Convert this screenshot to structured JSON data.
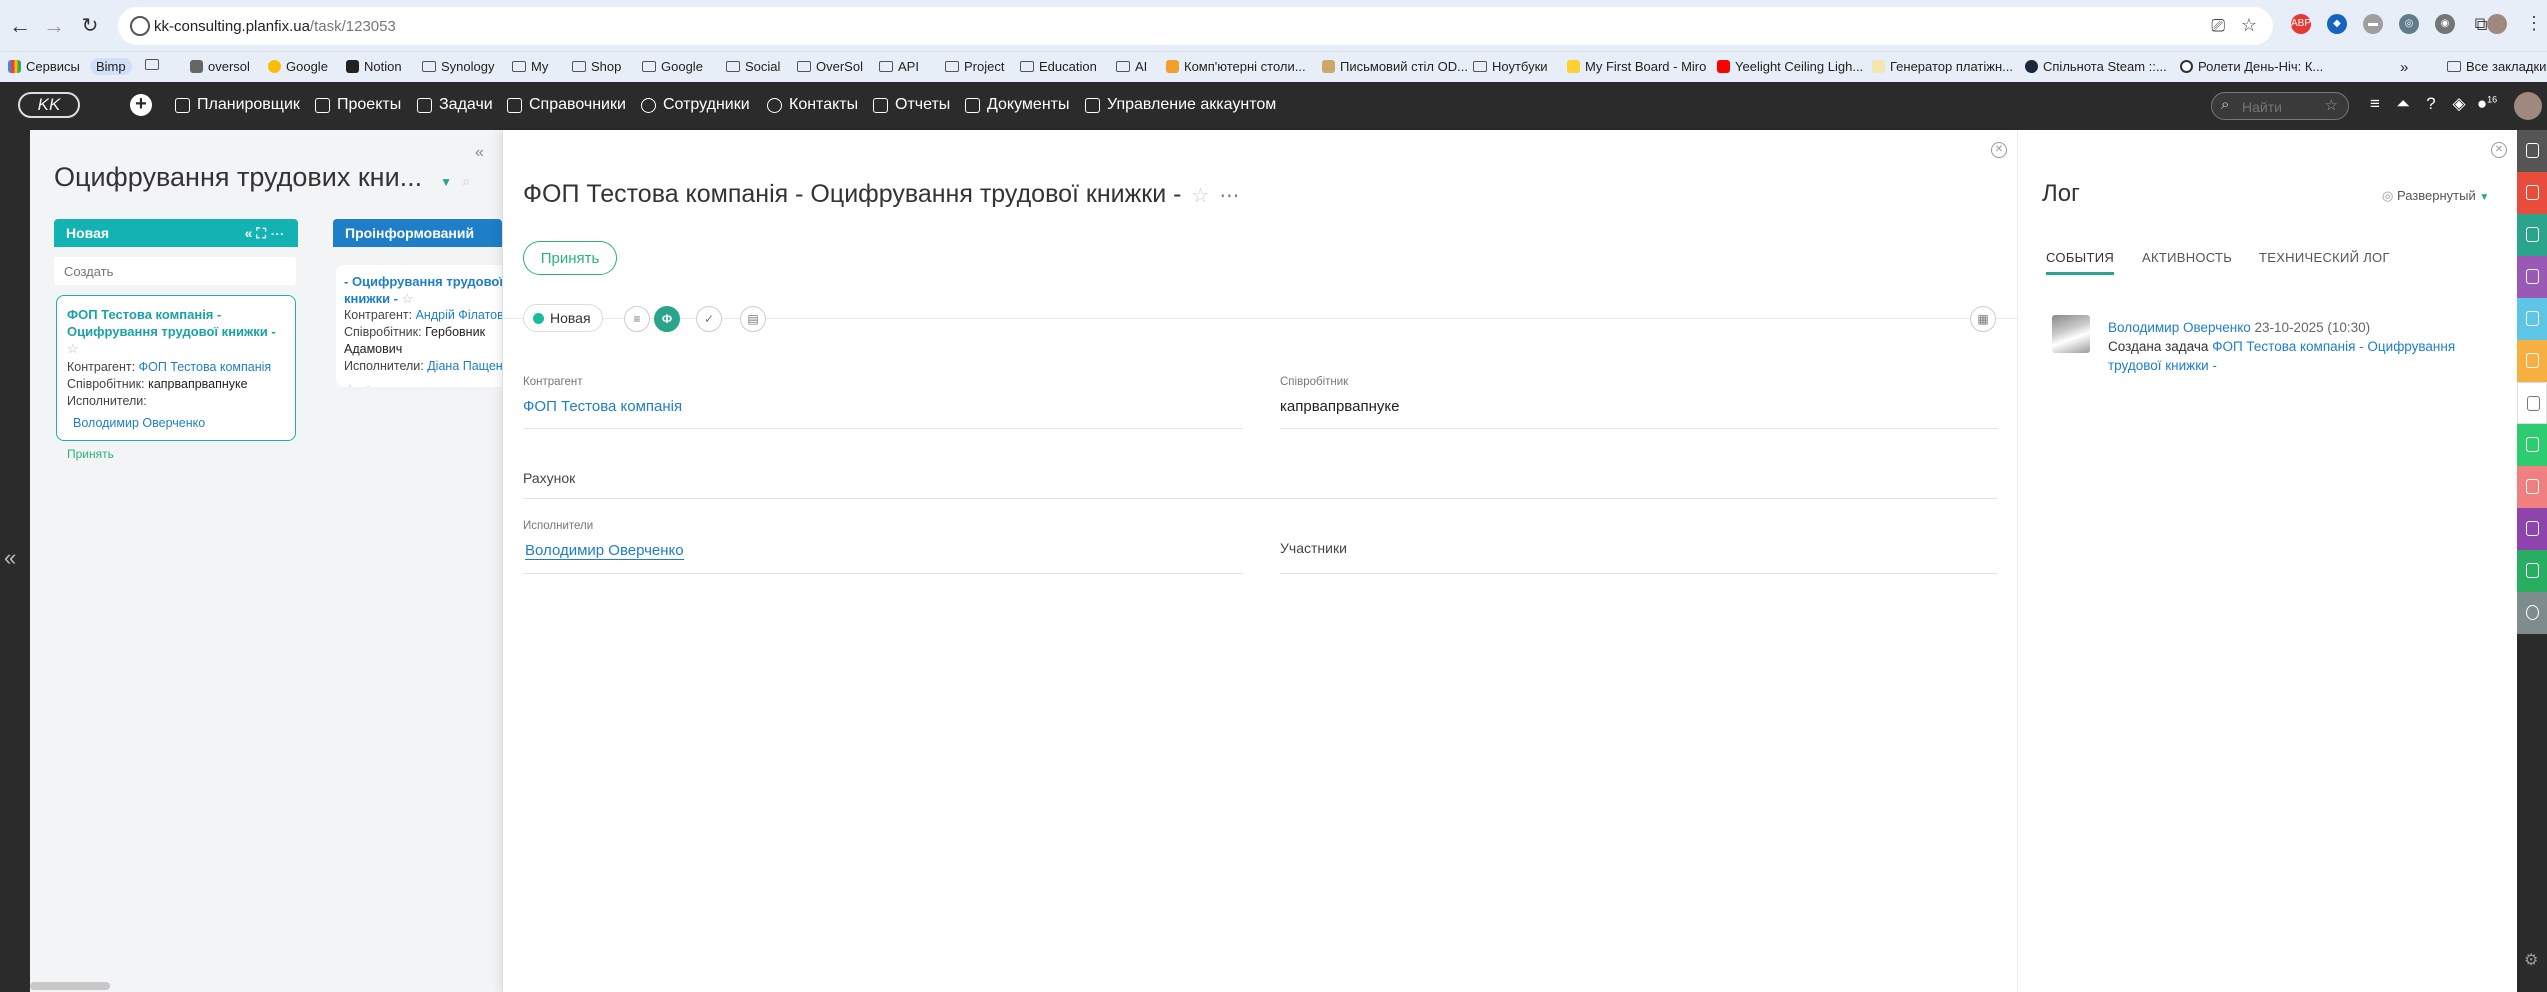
{
  "browser": {
    "url_domain": "kk-consulting.planfix.ua",
    "url_path": "/task/123053",
    "bookmarks": [
      {
        "label": "Сервисы",
        "icon": "grid-icon"
      },
      {
        "label": "Bimp",
        "icon": "bookmark-icon"
      },
      {
        "label": "",
        "icon": "apps-icon"
      },
      {
        "label": "oversol",
        "icon": "page-icon"
      },
      {
        "label": "Google",
        "icon": "google-icon"
      },
      {
        "label": "Notion",
        "icon": "notion-icon"
      },
      {
        "label": "Synology",
        "icon": "folder-icon"
      },
      {
        "label": "My",
        "icon": "folder-icon"
      },
      {
        "label": "Shop",
        "icon": "folder-icon"
      },
      {
        "label": "Google",
        "icon": "folder-icon"
      },
      {
        "label": "Social",
        "icon": "folder-icon"
      },
      {
        "label": "OverSol",
        "icon": "folder-icon"
      },
      {
        "label": "API",
        "icon": "folder-icon"
      },
      {
        "label": "Project",
        "icon": "folder-icon"
      },
      {
        "label": "Education",
        "icon": "folder-icon"
      },
      {
        "label": "AI",
        "icon": "folder-icon"
      },
      {
        "label": "Комп'ютерні столи...",
        "icon": "page-icon"
      },
      {
        "label": "Письмовий стіл OD...",
        "icon": "page-icon"
      },
      {
        "label": "Ноутбуки",
        "icon": "folder-icon"
      },
      {
        "label": "My First Board - Miro",
        "icon": "miro-icon"
      },
      {
        "label": "Yeelight Ceiling Ligh...",
        "icon": "youtube-icon"
      },
      {
        "label": "Генератор платіжн...",
        "icon": "page-icon"
      },
      {
        "label": "Спільнота Steam ::...",
        "icon": "steam-icon"
      },
      {
        "label": "Ролети День-Ніч: К...",
        "icon": "page-icon"
      }
    ],
    "bookmarks_all": "Все закладки"
  },
  "nav": {
    "items": [
      "Планировщик",
      "Проекты",
      "Задачи",
      "Справочники",
      "Сотрудники",
      "Контакты",
      "Отчеты",
      "Документы",
      "Управление аккаунтом"
    ],
    "search_placeholder": "Найти",
    "notif_count": "16"
  },
  "planner": {
    "title": "Оцифрування трудових кни...",
    "columns": [
      {
        "name": "Новая",
        "color": "#14b3b3"
      },
      {
        "name": "Проінформований",
        "color": "#1e7ec7"
      }
    ],
    "create_placeholder": "Создать",
    "card1": {
      "title": "ФОП Тестова компанія - Оцифрування трудової книжки -",
      "contragent_label": "Контрагент:",
      "contragent": "ФОП Тестова компанія",
      "employee_label": "Співробітник:",
      "employee": "капрвапрвапнуке",
      "executors_label": "Исполнители:",
      "executor": "Володимир Оверченко",
      "accept": "Принять"
    },
    "card2": {
      "title": "- Оцифрування трудової книжки -",
      "contragent_label": "Контрагент:",
      "contragent": "Андрій Філатов",
      "employee_label": "Співробітник:",
      "employee": "Гербовник Адамович",
      "executors_label": "Исполнители:",
      "executor": "Діана Пащенко"
    }
  },
  "task": {
    "title": "ФОП Тестова компанія - Оцифрування трудової книжки -",
    "accept": "Принять",
    "status": "Новая",
    "fields": {
      "contragent_label": "Контрагент",
      "contragent": "ФОП Тестова компанія",
      "employee_label": "Співробітник",
      "employee": "капрвапрвапнуке",
      "invoice_label": "Рахунок",
      "executors_label": "Исполнители",
      "executor": "Володимир Оверченко",
      "participants_label": "Участники"
    }
  },
  "log": {
    "title": "Лог",
    "mode": "Развернутый",
    "tabs": [
      "СОБЫТИЯ",
      "АКТИВНОСТЬ",
      "ТЕХНИЧЕСКИЙ ЛОГ"
    ],
    "entry": {
      "author": "Володимир Оверченко",
      "date": "23-10-2025 (10:30)",
      "action": "Создана задача",
      "link": "ФОП Тестова компанія - Оцифрування трудової книжки -"
    }
  },
  "right_bar_colors": [
    "#555555",
    "#e74c3c",
    "#2aa58b",
    "#9b59b6",
    "#5dc6e6",
    "#f5b041",
    "#ffffff",
    "#2ecc71",
    "#f08080",
    "#8e44ad",
    "#27ae60",
    "#7f8c8d"
  ]
}
